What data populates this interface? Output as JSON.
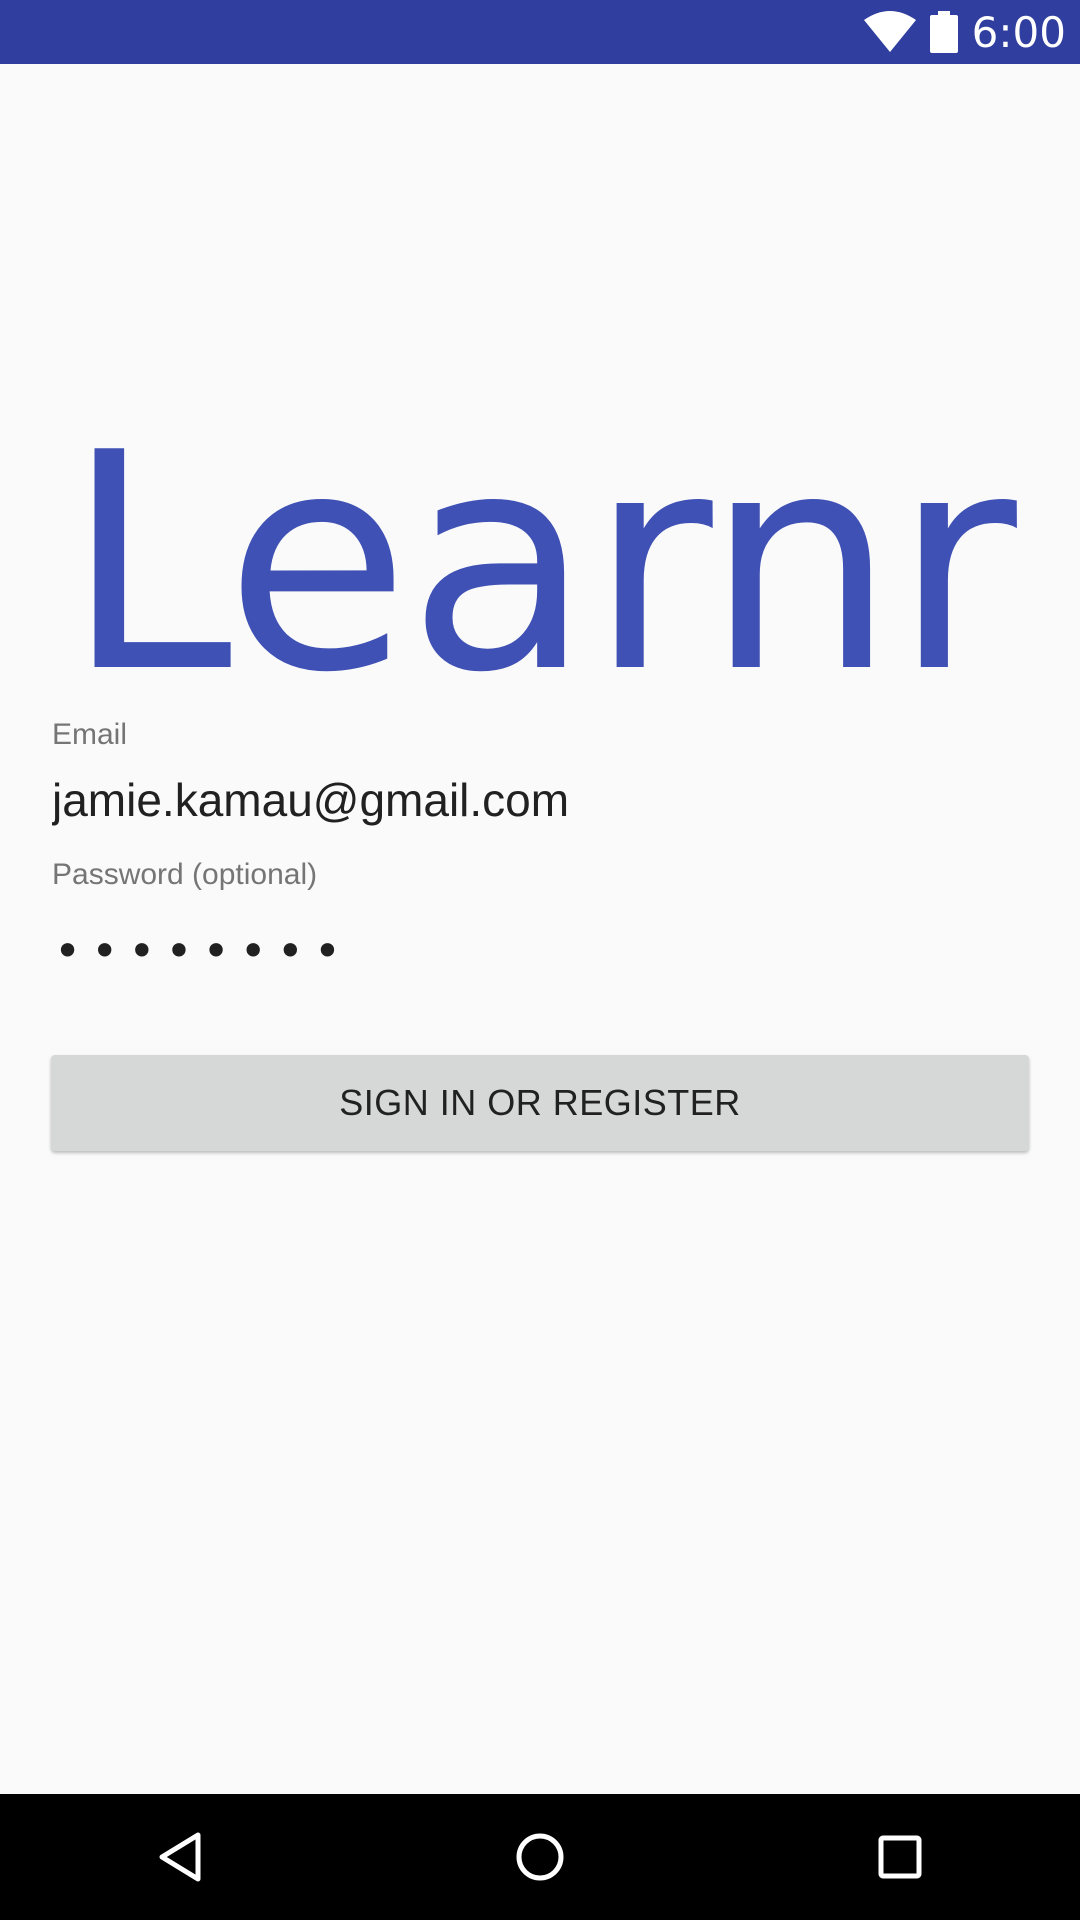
{
  "status_bar": {
    "time": "6:00",
    "icons": [
      "wifi-icon",
      "battery-icon"
    ],
    "background_color": "#303f9f"
  },
  "app": {
    "logo_text": "Learnr",
    "accent_color": "#3f51b5"
  },
  "form": {
    "email_label": "Email",
    "email_value": "jamie.kamau@gmail.com",
    "password_label": "Password (optional)",
    "password_mask": "••••••••",
    "submit_label": "SIGN IN OR REGISTER"
  },
  "nav_bar": {
    "icons": [
      "back-icon",
      "home-icon",
      "recents-icon"
    ]
  }
}
